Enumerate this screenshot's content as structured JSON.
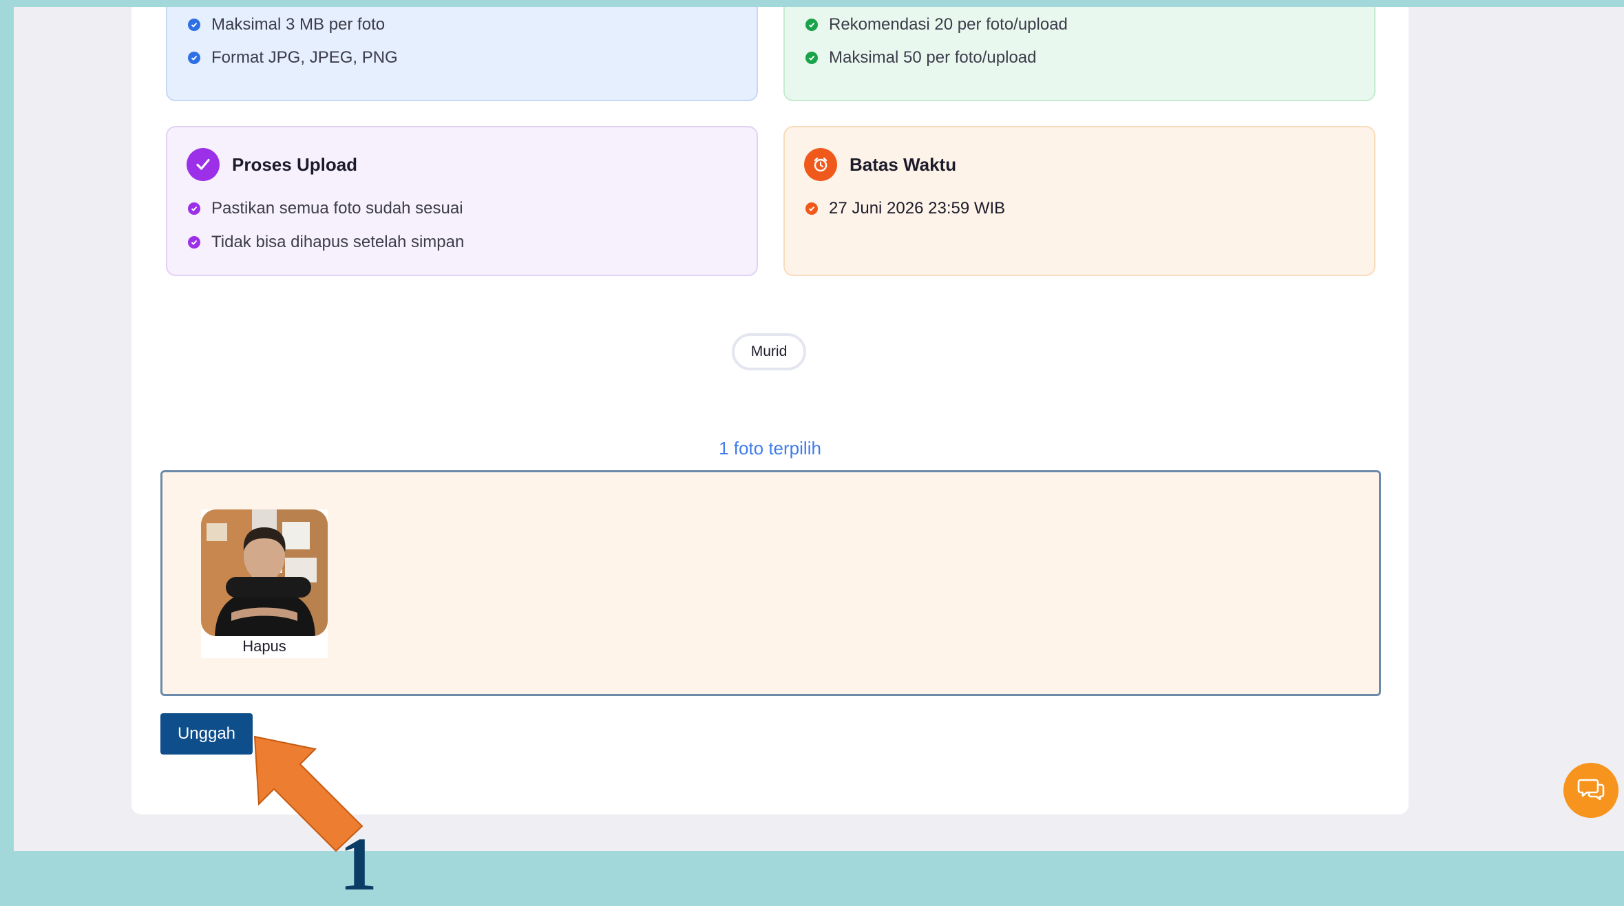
{
  "info": {
    "photo": {
      "items": [
        "Maksimal 3 MB per foto",
        "Format JPG, JPEG, PNG"
      ],
      "color": "#2f6fe4"
    },
    "count": {
      "items": [
        "Rekomendasi 20 per foto/upload",
        "Maksimal 50 per foto/upload"
      ],
      "color": "#1aa34a"
    },
    "process": {
      "title": "Proses Upload",
      "items": [
        "Pastikan semua foto sudah sesuai",
        "Tidak bisa dihapus setelah simpan"
      ],
      "color": "#9b30e8",
      "icon": "checkmark-icon"
    },
    "deadline": {
      "title": "Batas Waktu",
      "items": [
        "27 Juni 2026 23:59 WIB"
      ],
      "color": "#ef5a1c",
      "icon": "alarm-clock-icon"
    }
  },
  "filter": {
    "label": "Murid"
  },
  "upload": {
    "selected_count": "1 foto terpilih",
    "thumb_label": "Hapus",
    "button_label": "Unggah"
  },
  "annotation": {
    "step": "1",
    "color": "#ed7d31"
  },
  "chat": {
    "icon": "chat-bubbles-icon",
    "color": "#f7941d"
  }
}
